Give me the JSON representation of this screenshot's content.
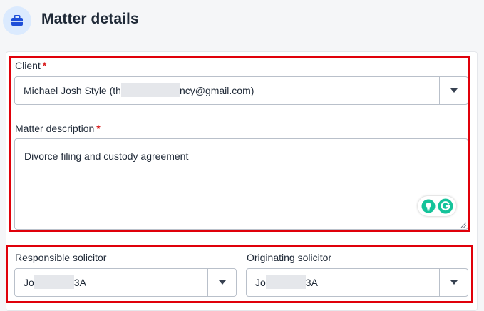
{
  "header": {
    "title": "Matter details",
    "icon": "briefcase-icon"
  },
  "client": {
    "label": "Client",
    "required_mark": "*",
    "value_prefix": "Michael Josh Style (th",
    "value_suffix": "ncy@gmail.com)"
  },
  "matter_description": {
    "label": "Matter description",
    "required_mark": "*",
    "value": "Divorce filing and custody agreement"
  },
  "responsible_solicitor": {
    "label": "Responsible solicitor",
    "value_prefix": "Jo",
    "value_suffix": "3A"
  },
  "originating_solicitor": {
    "label": "Originating solicitor",
    "value_prefix": "Jo",
    "value_suffix": "3A"
  },
  "colors": {
    "highlight": "#e0000a",
    "required": "#d91c1c",
    "grammarly": "#15c39a",
    "icon_accent": "#1d4ed8"
  }
}
